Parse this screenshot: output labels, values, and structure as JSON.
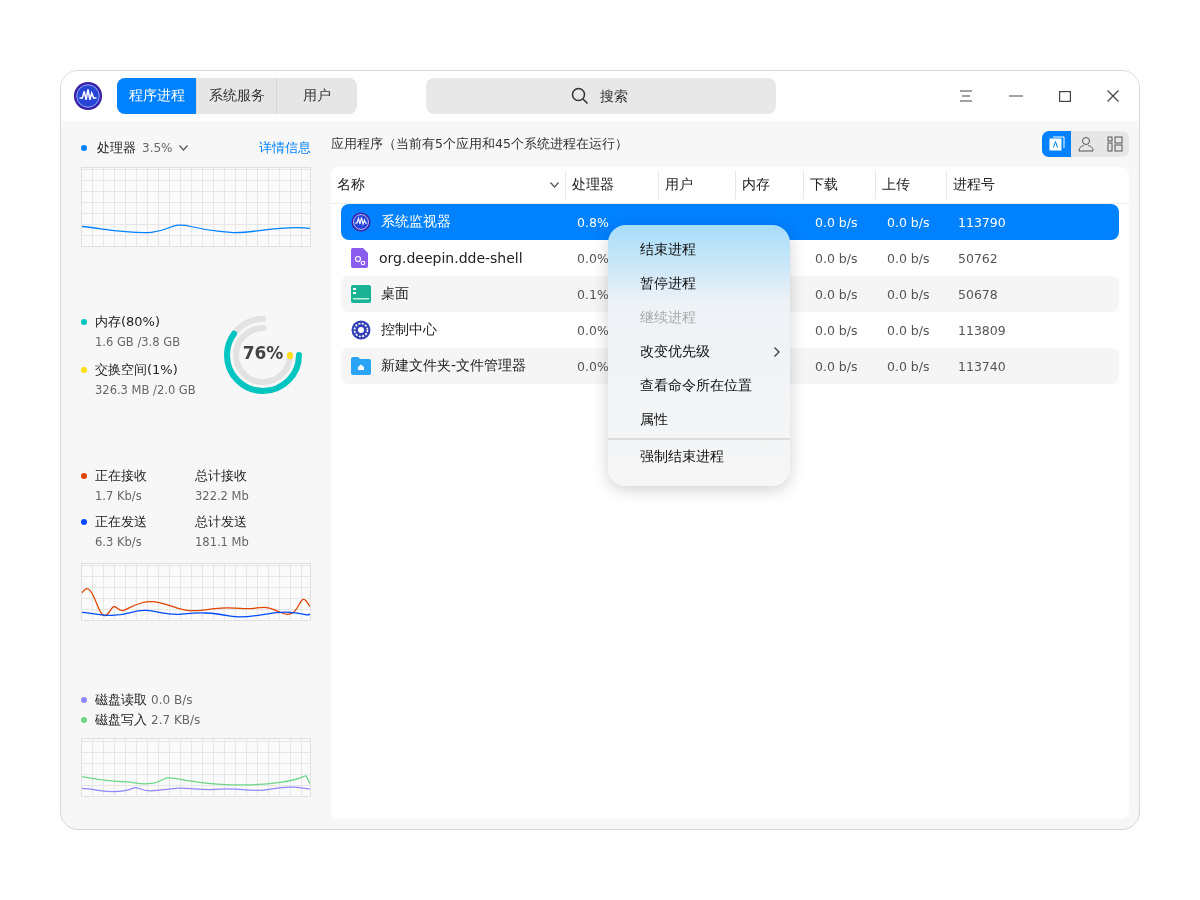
{
  "tabs": [
    {
      "label": "程序进程",
      "selected": true
    },
    {
      "label": "系统服务",
      "selected": false
    },
    {
      "label": "用户",
      "selected": false
    }
  ],
  "search": {
    "placeholder": "搜索"
  },
  "sidebar": {
    "cpu": {
      "label": "处理器",
      "value": "3.5%",
      "link": "详情信息",
      "color": "#0081ff"
    },
    "memory": {
      "items": [
        {
          "label": "内存(80%)",
          "detail": "1.6 GB /3.8 GB",
          "color": "#00c5c0",
          "level": 0.8
        },
        {
          "label": "交换空间(1%)",
          "detail": "326.3 MB /2.0 GB",
          "color": "#fedf19",
          "level": 0.01
        }
      ],
      "gauge_text": "76%"
    },
    "network": [
      {
        "label": "正在接收",
        "value": "1.7 Kb/s",
        "color": "#e14300",
        "total_label": "总计接收",
        "total_value": "322.2 Mb"
      },
      {
        "label": "正在发送",
        "value": "6.3 Kb/s",
        "color": "#004bff",
        "total_label": "总计发送",
        "total_value": "181.1 Mb"
      }
    ],
    "disk": [
      {
        "label": "磁盘读取",
        "value": "0.0 B/s",
        "color": "#8f88ff"
      },
      {
        "label": "磁盘写入",
        "value": "2.7 KB/s",
        "color": "#6ad787"
      }
    ]
  },
  "content": {
    "title": "应用程序（当前有5个应用和45个系统进程在运行）",
    "views": [
      {
        "kind": "apps",
        "selected": true
      },
      {
        "kind": "user",
        "selected": false
      },
      {
        "kind": "all",
        "selected": false
      }
    ],
    "columns": [
      "名称",
      "处理器",
      "用户",
      "内存",
      "下载",
      "上传",
      "进程号"
    ],
    "rows": [
      {
        "kind": "monitor",
        "name": "系统监视器",
        "cpu": "0.8%",
        "download": "0.0 b/s",
        "upload": "0.0 b/s",
        "pid": "113790",
        "selected": true
      },
      {
        "kind": "plugin",
        "name": "org.deepin.dde-shell",
        "cpu": "0.0%",
        "download": "0.0 b/s",
        "upload": "0.0 b/s",
        "pid": "50762",
        "selected": false
      },
      {
        "kind": "desktop",
        "name": "桌面",
        "cpu": "0.1%",
        "download": "0.0 b/s",
        "upload": "0.0 b/s",
        "pid": "50678",
        "selected": false
      },
      {
        "kind": "control",
        "name": "控制中心",
        "cpu": "0.0%",
        "download": "0.0 b/s",
        "upload": "0.0 b/s",
        "pid": "113809",
        "selected": false
      },
      {
        "kind": "folder",
        "name": "新建文件夹-文件管理器",
        "cpu": "0.0%",
        "download": "0.0 b/s",
        "upload": "0.0 b/s",
        "pid": "113740",
        "selected": false
      }
    ]
  },
  "context_menu": [
    {
      "label": "结束进程",
      "disabled": false,
      "submenu": false,
      "separator_before": false
    },
    {
      "label": "暂停进程",
      "disabled": false,
      "submenu": false,
      "separator_before": false
    },
    {
      "label": "继续进程",
      "disabled": true,
      "submenu": false,
      "separator_before": false
    },
    {
      "label": "改变优先级",
      "disabled": false,
      "submenu": true,
      "separator_before": false
    },
    {
      "label": "查看命令所在位置",
      "disabled": false,
      "submenu": false,
      "separator_before": false
    },
    {
      "label": "属性",
      "disabled": false,
      "submenu": false,
      "separator_before": false
    },
    {
      "label": "强制结束进程",
      "disabled": false,
      "submenu": false,
      "separator_before": true
    }
  ]
}
